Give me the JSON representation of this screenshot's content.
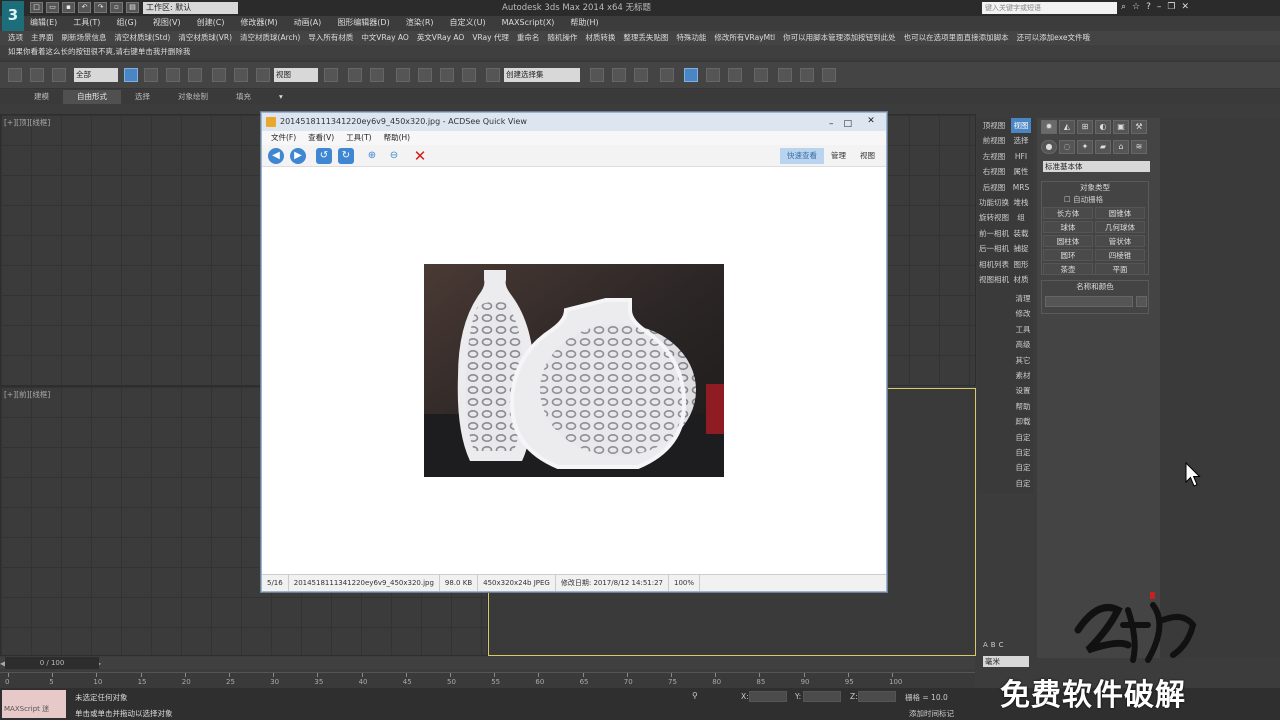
{
  "app": {
    "title": "Autodesk 3ds Max  2014 x64    无标题",
    "workspace": "工作区: 默认",
    "search_placeholder": "键入关键字或短语"
  },
  "menus": [
    "编辑(E)",
    "工具(T)",
    "组(G)",
    "视图(V)",
    "创建(C)",
    "修改器(M)",
    "动画(A)",
    "图形编辑器(D)",
    "渲染(R)",
    "自定义(U)",
    "MAXScript(X)",
    "帮助(H)"
  ],
  "script_buttons": [
    "选项",
    "主界面",
    "刷新场景信息",
    "清空材质球(Std)",
    "清空材质球(VR)",
    "清空材质球(Arch)",
    "导入所有材质",
    "中文VRay AO",
    "英文VRay AO",
    "VRay 代理",
    "重命名",
    "随机操作",
    "材质转换",
    "整理丢失贴图",
    "特殊功能",
    "修改所有VRayMtl",
    "你可以用脚本管理添加按钮到此处",
    "也可以在选项里面直接添加脚本",
    "还可以添加exe文件哦"
  ],
  "hint_text": "如果你看着这么长的按钮很不爽,请右键单击我并删除我",
  "toolbar": {
    "selection_filter": "全部",
    "reference_coord": "视图",
    "named_selection": "创建选择集"
  },
  "ribbon_tabs": [
    "建模",
    "自由形式",
    "选择",
    "对象绘制",
    "填充"
  ],
  "viewports": {
    "top_label": "[+][顶][线框]",
    "front_label": "[+][前][线框]"
  },
  "cmd_nav_left": [
    "顶视图",
    "前视图",
    "左视图",
    "右视图",
    "后视图",
    "功能切换",
    "旋转视图",
    "前一相机",
    "后一相机",
    "相机列表",
    "视图相机"
  ],
  "cmd_nav_right_top": [
    "视图",
    "选择",
    "HFI",
    "属性",
    "MRS",
    "堆栈",
    "组",
    "装载",
    "捕捉",
    "图形",
    "材质"
  ],
  "cmd_nav_right_bottom": [
    "清理",
    "修改",
    "工具",
    "高级",
    "其它",
    "素材",
    "设置",
    "帮助",
    "卸载",
    "自定",
    "自定",
    "自定",
    "自定"
  ],
  "panel": {
    "category": "标准基本体",
    "object_type_title": "对象类型",
    "autogrid": "自动栅格",
    "objects": [
      "长方体",
      "圆锥体",
      "球体",
      "几何球体",
      "圆柱体",
      "管状体",
      "圆环",
      "四棱锥",
      "茶壶",
      "平面"
    ],
    "name_color_title": "名称和颜色"
  },
  "timeline": {
    "slider": "0 / 100",
    "ticks": [
      "0",
      "5",
      "10",
      "15",
      "20",
      "25",
      "30",
      "35",
      "40",
      "45",
      "50",
      "55",
      "60",
      "65",
      "70",
      "75",
      "80",
      "85",
      "90",
      "95",
      "100"
    ]
  },
  "status": {
    "maxscript": "MAXScript 迷",
    "selection": "未选定任何对象",
    "prompt": "单击或单击并拖动以选择对象",
    "x_label": "X:",
    "y_label": "Y:",
    "z_label": "Z:",
    "grid": "栅格 = 10.0",
    "add_time_tag": "添加时间标记",
    "units": "毫米",
    "abc": [
      "A",
      "B",
      "C"
    ]
  },
  "acdsee": {
    "title": "2014518111341220ey6v9_450x320.jpg - ACDSee Quick View",
    "menus": [
      "文件(F)",
      "查看(V)",
      "工具(T)",
      "帮助(H)"
    ],
    "tabs": [
      "快速查看",
      "管理",
      "视图"
    ],
    "status": [
      "5/16",
      "2014518111341220ey6v9_450x320.jpg",
      "98.0 KB",
      "450x320x24b JPEG",
      "修改日期: 2017/8/12 14:51:27",
      "100%"
    ]
  },
  "watermark": "免费软件破解",
  "colors": {
    "accent": "#4a86c4",
    "viewport_active_border": "#d8c96a",
    "maxscript_bg": "#e8c9c9"
  }
}
